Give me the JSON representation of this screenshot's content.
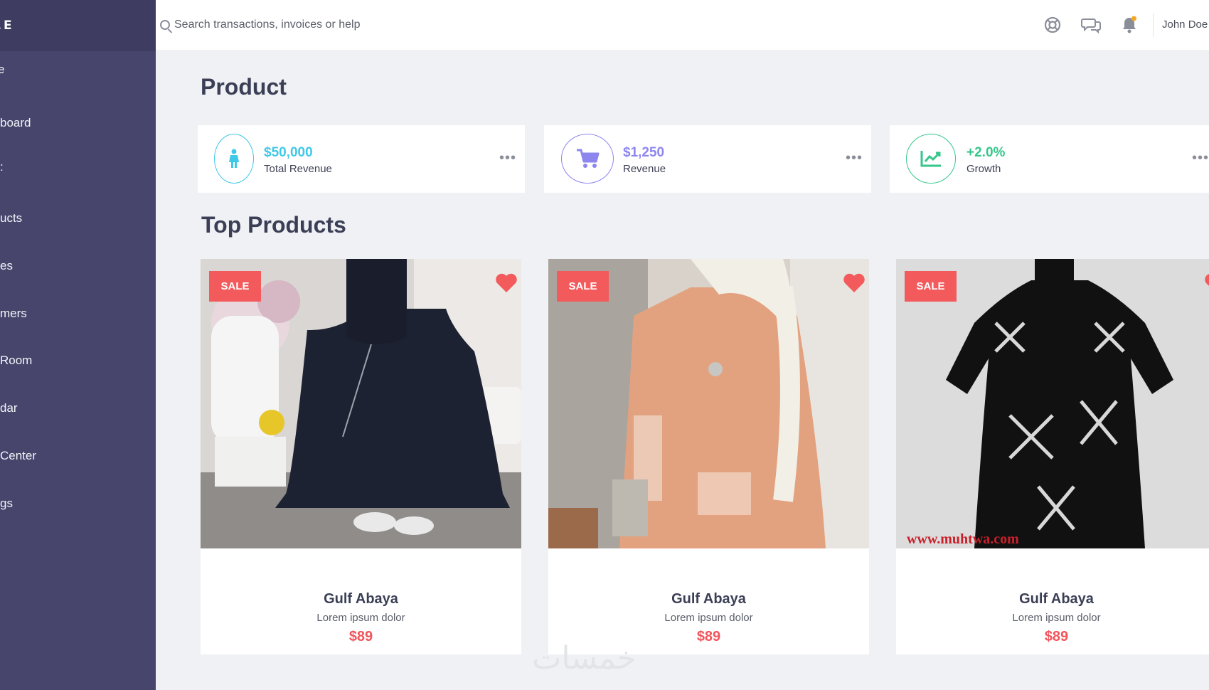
{
  "sidebar": {
    "brand": "ABLE",
    "items": [
      {
        "label": "e"
      },
      {
        "label": "board"
      },
      {
        "label": ":"
      },
      {
        "label": "ucts"
      },
      {
        "label": "es"
      },
      {
        "label": "mers"
      },
      {
        "label": "Room"
      },
      {
        "label": "dar"
      },
      {
        "label": "Center"
      },
      {
        "label": "gs"
      }
    ]
  },
  "header": {
    "search_placeholder": "Search transactions, invoices or help",
    "icons": [
      "support-icon",
      "chat-icon",
      "bell-icon"
    ],
    "user_name": "John Doe"
  },
  "page": {
    "title": "Product",
    "section_title": "Top Products"
  },
  "stats": [
    {
      "value": "$50,000",
      "label": "Total Revenue",
      "icon": "person-icon",
      "color": "#3fc9e8"
    },
    {
      "value": "$1,250",
      "label": "Revenue",
      "icon": "cart-icon",
      "color": "#8d86ef"
    },
    {
      "value": "+2.0%",
      "label": "Growth",
      "icon": "chart-icon",
      "color": "#35c68a"
    }
  ],
  "products": [
    {
      "badge": "SALE",
      "name": "Gulf Abaya",
      "description": "Lorem ipsum dolor",
      "price": "$89"
    },
    {
      "badge": "SALE",
      "name": "Gulf Abaya",
      "description": "Lorem ipsum dolor",
      "price": "$89"
    },
    {
      "badge": "SALE",
      "name": "Gulf Abaya",
      "description": "Lorem ipsum dolor",
      "price": "$89",
      "image_text": "www.muhtwa.com"
    }
  ],
  "watermark": "خمسات",
  "colors": {
    "sidebar": "#47456b",
    "accent_red": "#f25a5c",
    "background": "#f0f1f5"
  }
}
